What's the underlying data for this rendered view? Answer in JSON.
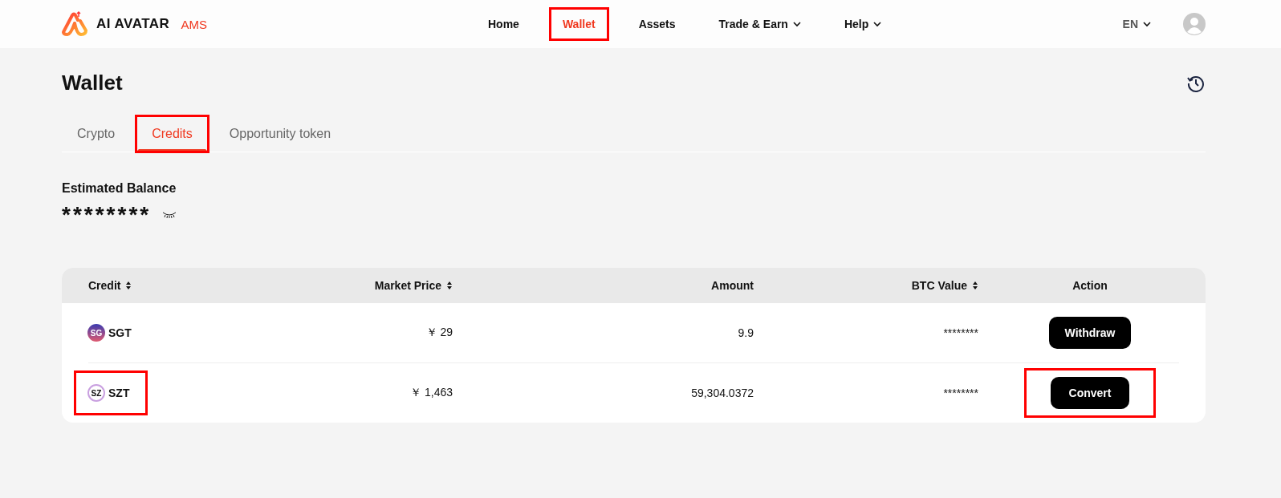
{
  "header": {
    "logo_text": "AI AVATAR",
    "logo_badge": "AMS",
    "nav": [
      {
        "label": "Home",
        "selected": false,
        "highlighted": false,
        "dropdown": false
      },
      {
        "label": "Wallet",
        "selected": true,
        "highlighted": true,
        "dropdown": false
      },
      {
        "label": "Assets",
        "selected": false,
        "highlighted": false,
        "dropdown": false
      },
      {
        "label": "Trade & Earn",
        "selected": false,
        "highlighted": false,
        "dropdown": true
      },
      {
        "label": "Help",
        "selected": false,
        "highlighted": false,
        "dropdown": true
      }
    ],
    "language": "EN"
  },
  "page": {
    "title": "Wallet",
    "tabs": [
      {
        "label": "Crypto",
        "selected": false,
        "highlighted": false
      },
      {
        "label": "Credits",
        "selected": true,
        "highlighted": true
      },
      {
        "label": "Opportunity token",
        "selected": false,
        "highlighted": false
      }
    ],
    "balance": {
      "label": "Estimated Balance",
      "value": "********",
      "hidden": true
    },
    "table": {
      "columns": [
        {
          "label": "Credit",
          "sortable": true
        },
        {
          "label": "Market Price",
          "sortable": true
        },
        {
          "label": "Amount",
          "sortable": false
        },
        {
          "label": "BTC Value",
          "sortable": true
        },
        {
          "label": "Action",
          "sortable": false
        }
      ],
      "rows": [
        {
          "icon_text": "SG",
          "kind": "filled",
          "credit": "SGT",
          "market_price": "￥ 29",
          "amount": "9.9",
          "btc_value": "********",
          "action": "Withdraw",
          "highlighted": false
        },
        {
          "icon_text": "SZ",
          "kind": "ring",
          "credit": "SZT",
          "market_price": "￥ 1,463",
          "amount": "59,304.0372",
          "btc_value": "********",
          "action": "Convert",
          "highlighted": true
        }
      ]
    }
  }
}
